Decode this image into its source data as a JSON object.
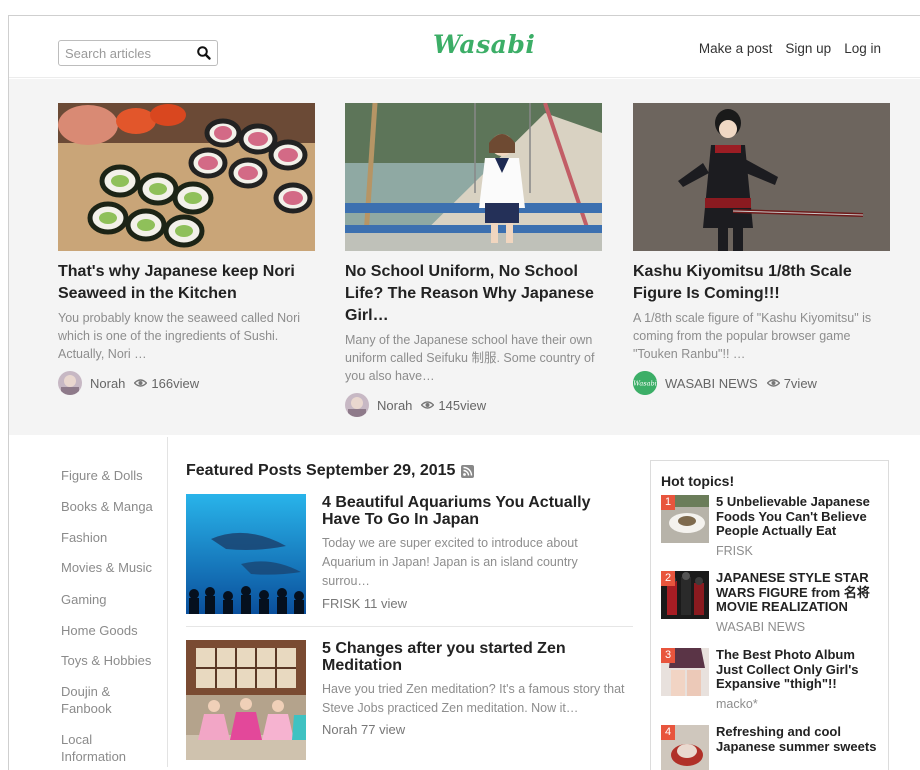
{
  "header": {
    "search_placeholder": "Search articles",
    "logo": "Wasabi",
    "nav": [
      "Make a post",
      "Sign up",
      "Log in"
    ]
  },
  "top_cards": [
    {
      "title": "That's why Japanese keep Nori Seaweed in the Kitchen",
      "desc": "You probably know the seaweed called Nori which is one of the ingredients of Sushi. Actually, Nori …",
      "author": "Norah",
      "views": "166view"
    },
    {
      "title": "No School Uniform, No School Life? The Reason Why Japanese Girl…",
      "desc": "Many of the Japanese school have their own uniform called Seifuku 制服. Some country of you also have…",
      "author": "Norah",
      "views": "145view"
    },
    {
      "title": "Kashu Kiyomitsu 1/8th Scale Figure Is Coming!!!",
      "desc": "A 1/8th scale figure of \"Kashu Kiyomitsu\" is coming from the popular browser game \"Touken Ranbu\"!! …",
      "author": "WASABI NEWS",
      "author_badge": "wasabi",
      "views": "7view"
    }
  ],
  "sidebar": [
    "Figure & Dolls",
    "Books & Manga",
    "Fashion",
    "Movies & Music",
    "Gaming",
    "Home Goods",
    "Toys & Hobbies",
    "Doujin & Fanbook",
    "Local Information"
  ],
  "featured": {
    "heading": "Featured Posts September 29, 2015",
    "posts": [
      {
        "title": "4 Beautiful Aquariums You Actually Have To Go In Japan",
        "desc": "Today we are super excited to introduce about Aquarium in Japan! Japan is an island country surrou…",
        "meta": "FRISK  11 view"
      },
      {
        "title": "5 Changes after you started Zen Meditation",
        "desc": "Have you tried Zen meditation? It's a famous story that Steve Jobs practiced Zen meditation. Now it…",
        "meta": "Norah  77 view"
      }
    ]
  },
  "hot_topics": {
    "title": "Hot topics!",
    "items": [
      {
        "rank": "1",
        "title": "5 Unbelievable Japanese Foods You Can't Believe People Actually Eat",
        "source": "FRISK"
      },
      {
        "rank": "2",
        "title": "JAPANESE STYLE STAR WARS FIGURE from 名将 MOVIE REALIZATION",
        "source": "WASABI NEWS"
      },
      {
        "rank": "3",
        "title": "The Best Photo Album Just Collect Only Girl's Expansive \"thigh\"!!",
        "source": "macko*"
      },
      {
        "rank": "4",
        "title": "Refreshing and cool Japanese summer sweets",
        "source": ""
      }
    ]
  },
  "colors": {
    "brand_green": "#3cae67",
    "rank_red": "#e8553d",
    "muted_text": "#8d8d8d",
    "band_bg": "#f4f4f4"
  }
}
